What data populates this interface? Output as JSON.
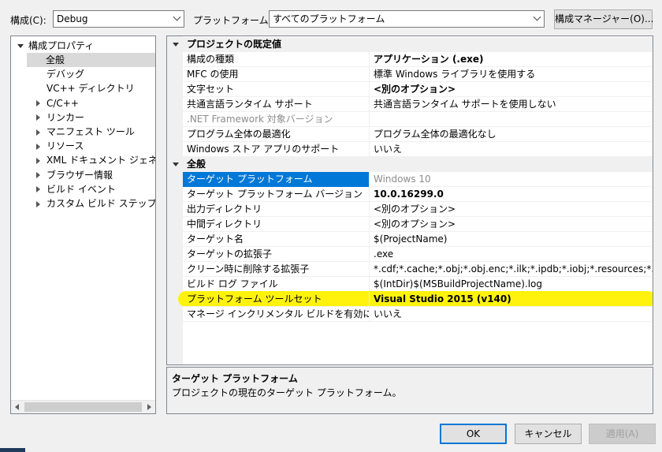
{
  "toolbar": {
    "config_label": "構成(C):",
    "config_value": "Debug",
    "platform_label": "プラットフォーム(P):",
    "platform_value": "すべてのプラットフォーム",
    "config_manager_label": "構成マネージャー(O)..."
  },
  "tree": {
    "root": "構成プロパティ",
    "items": [
      {
        "label": "全般",
        "expandable": false,
        "selected": true
      },
      {
        "label": "デバッグ",
        "expandable": false
      },
      {
        "label": "VC++ ディレクトリ",
        "expandable": false
      },
      {
        "label": "C/C++",
        "expandable": true
      },
      {
        "label": "リンカー",
        "expandable": true
      },
      {
        "label": "マニフェスト ツール",
        "expandable": true
      },
      {
        "label": "リソース",
        "expandable": true
      },
      {
        "label": "XML ドキュメント ジェネレーター",
        "expandable": true
      },
      {
        "label": "ブラウザー情報",
        "expandable": true
      },
      {
        "label": "ビルド イベント",
        "expandable": true
      },
      {
        "label": "カスタム ビルド ステップ",
        "expandable": true
      }
    ]
  },
  "grid": {
    "cat1": "プロジェクトの既定値",
    "cat1_rows": [
      {
        "name": "構成の種類",
        "value": "アプリケーション (.exe)",
        "bold": true
      },
      {
        "name": "MFC の使用",
        "value": "標準 Windows ライブラリを使用する"
      },
      {
        "name": "文字セット",
        "value": "<別のオプション>",
        "bold": true
      },
      {
        "name": "共通言語ランタイム サポート",
        "value": "共通言語ランタイム サポートを使用しない"
      },
      {
        "name": ".NET Framework 対象バージョン",
        "value": "",
        "dim": true
      },
      {
        "name": "プログラム全体の最適化",
        "value": "プログラム全体の最適化なし"
      },
      {
        "name": "Windows ストア アプリのサポート",
        "value": "いいえ"
      }
    ],
    "cat2": "全般",
    "cat2_rows": [
      {
        "name": "ターゲット プラットフォーム",
        "value": "Windows 10",
        "selected": true,
        "dimval": true
      },
      {
        "name": "ターゲット プラットフォーム バージョン",
        "value": "10.0.16299.0",
        "bold": true
      },
      {
        "name": "出力ディレクトリ",
        "value": "<別のオプション>"
      },
      {
        "name": "中間ディレクトリ",
        "value": "<別のオプション>"
      },
      {
        "name": "ターゲット名",
        "value": "$(ProjectName)"
      },
      {
        "name": "ターゲットの拡張子",
        "value": ".exe"
      },
      {
        "name": "クリーン時に削除する拡張子",
        "value": "*.cdf;*.cache;*.obj;*.obj.enc;*.ilk;*.ipdb;*.iobj;*.resources;*.tlb;*.tli;*.t"
      },
      {
        "name": "ビルド ログ ファイル",
        "value": "$(IntDir)$(MSBuildProjectName).log"
      },
      {
        "name": "プラットフォーム ツールセット",
        "value": "Visual Studio 2015 (v140)",
        "bold": true
      },
      {
        "name": "マネージ インクリメンタル ビルドを有効にする",
        "value": "いいえ"
      }
    ]
  },
  "description": {
    "title": "ターゲット プラットフォーム",
    "text": "プロジェクトの現在のターゲット プラットフォーム。"
  },
  "buttons": {
    "ok": "OK",
    "cancel": "キャンセル",
    "apply": "適用(A)"
  },
  "colors": {
    "selection": "#0078d7",
    "highlight": "#fff200"
  }
}
